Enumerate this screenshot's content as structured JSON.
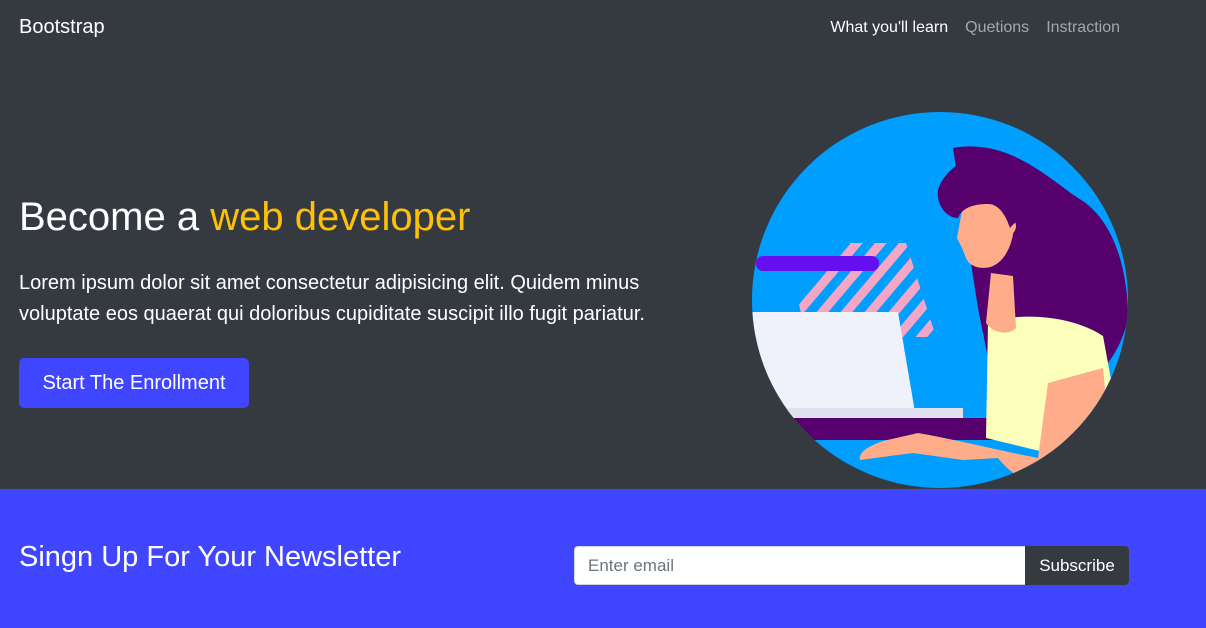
{
  "navbar": {
    "brand": "Bootstrap",
    "links": [
      {
        "label": "What you'll learn",
        "active": true
      },
      {
        "label": "Quetions",
        "active": false
      },
      {
        "label": "Instraction",
        "active": false
      }
    ]
  },
  "hero": {
    "title_prefix": "Become a ",
    "title_highlight": "web developer",
    "text": "Lorem ipsum dolor sit amet consectetur adipisicing elit. Quidem minus voluptate eos quaerat qui doloribus cupiditate suscipit illo fugit pariatur.",
    "button_label": "Start The Enrollment",
    "illustration_icon": "woman-at-laptop-illustration"
  },
  "newsletter": {
    "title": "Singn Up For Your Newsletter",
    "email_placeholder": "Enter email",
    "email_value": "",
    "button_label": "Subscribe"
  },
  "colors": {
    "dark": "#343a40",
    "primary": "#4046ff",
    "highlight": "#ffc107",
    "circle": "#009eff",
    "hair": "#55006c"
  }
}
